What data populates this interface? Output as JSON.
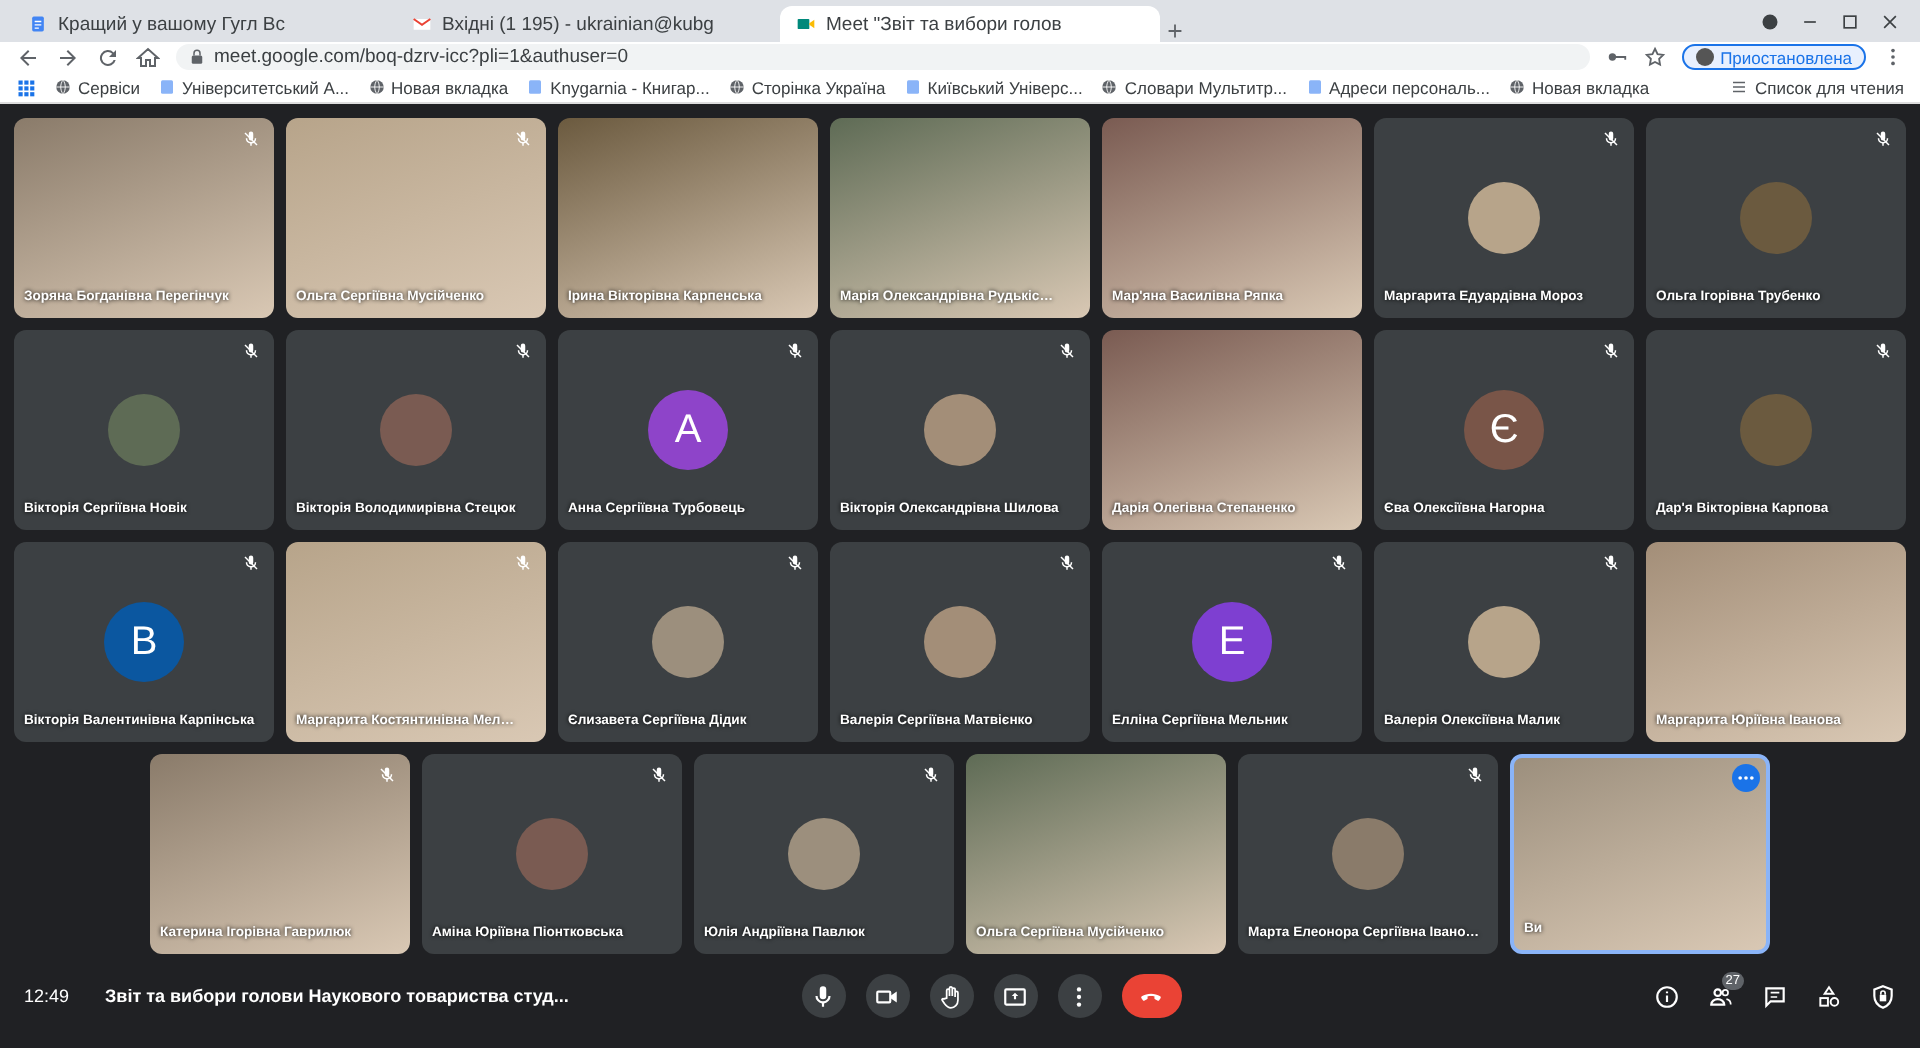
{
  "browser": {
    "tabs": [
      {
        "title": "Кращий у вашому Гугл Вс",
        "selected": false,
        "kind": "docs"
      },
      {
        "title": "Вхідні (1 195) - ukrainian@kubg",
        "selected": false,
        "kind": "mail"
      },
      {
        "title": "Meet \"Звіт та вибори голов",
        "selected": true,
        "kind": "meet"
      }
    ],
    "url": "meet.google.com/boq-dzrv-icc?pli=1&authuser=0",
    "profile": "Приостановлена",
    "bookmarks": [
      "Сервіси",
      "Університетський А...",
      "Новая вкладка",
      "Knygarnia - Книгар...",
      "Сторінка Україна",
      "Київський Універс...",
      "Словари Мультитр...",
      "Адреси персональ...",
      "Новая вкладка"
    ],
    "reading_list": "Список для чтения"
  },
  "rows": [
    [
      {
        "name": "Зоряна Богданівна Перегінчук",
        "kind": "video",
        "muted": true,
        "you": false
      },
      {
        "name": "Ольга Сергіївна Мусійченко",
        "kind": "video",
        "muted": true,
        "you": false
      },
      {
        "name": "Ірина Вікторівна Карпенська",
        "kind": "video",
        "muted": false,
        "you": false
      },
      {
        "name": "Марія Олександрівна Рудькіс…",
        "kind": "video",
        "muted": false,
        "you": false
      },
      {
        "name": "Мар'яна Василівна Ряпка",
        "kind": "video",
        "muted": false,
        "you": false
      },
      {
        "name": "Маргарита Едуардівна Мороз",
        "kind": "photo",
        "muted": true,
        "you": false
      },
      {
        "name": "Ольга Ігорівна Трубенко",
        "kind": "photo",
        "muted": true,
        "you": false
      }
    ],
    [
      {
        "name": "Вікторія Сергіївна Новік",
        "kind": "photo",
        "muted": true,
        "you": false
      },
      {
        "name": "Вікторія Володимирівна Стецюк",
        "kind": "photo",
        "muted": true,
        "you": false
      },
      {
        "name": "Анна Сергіївна Турбовець",
        "kind": "letter",
        "letter": "A",
        "color": "#8e44c9",
        "muted": true,
        "you": false
      },
      {
        "name": "Вікторія Олександрівна Шилова",
        "kind": "photo",
        "muted": true,
        "you": false
      },
      {
        "name": "Дарія Олегівна Степаненко",
        "kind": "video",
        "muted": false,
        "you": false
      },
      {
        "name": "Єва Олексіївна Нагорна",
        "kind": "letter",
        "letter": "Є",
        "color": "#795548",
        "muted": true,
        "you": false
      },
      {
        "name": "Дар'я Вікторівна Карпова",
        "kind": "photo",
        "muted": true,
        "you": false
      }
    ],
    [
      {
        "name": "Вікторія Валентинівна Карпінська",
        "kind": "letter",
        "letter": "В",
        "color": "#0b57a0",
        "muted": true,
        "you": false
      },
      {
        "name": "Маргарита Костянтинівна Мел…",
        "kind": "video",
        "muted": true,
        "you": false
      },
      {
        "name": "Єлизавета Сергіївна Дідик",
        "kind": "photo",
        "muted": true,
        "you": false
      },
      {
        "name": "Валерія Сергіївна Матвієнко",
        "kind": "photo",
        "muted": true,
        "you": false
      },
      {
        "name": "Елліна Сергіївна Мельник",
        "kind": "letter",
        "letter": "E",
        "color": "#7e3fd1",
        "muted": true,
        "you": false
      },
      {
        "name": "Валерія Олексіївна Малик",
        "kind": "photo",
        "muted": true,
        "you": false
      },
      {
        "name": "Маргарита Юріївна Іванова",
        "kind": "video",
        "muted": false,
        "you": false
      }
    ],
    [
      {
        "name": "Катерина Ігорівна Гаврилюк",
        "kind": "video",
        "muted": true,
        "you": false
      },
      {
        "name": "Аміна Юріївна Піонтковська",
        "kind": "photo",
        "muted": true,
        "you": false
      },
      {
        "name": "Юлія Андріївна Павлюк",
        "kind": "photo",
        "muted": true,
        "you": false
      },
      {
        "name": "Ольга Сергіївна Мусійченко",
        "kind": "video",
        "muted": false,
        "you": false
      },
      {
        "name": "Марта Елеонора Сергіївна Івано…",
        "kind": "photo",
        "muted": true,
        "you": false
      },
      {
        "name": "Ви",
        "kind": "video",
        "muted": false,
        "you": true
      }
    ]
  ],
  "toolbar": {
    "time": "12:49",
    "meeting_title": "Звіт та вибори голови Наукового товариства студ...",
    "people_count": "27"
  }
}
